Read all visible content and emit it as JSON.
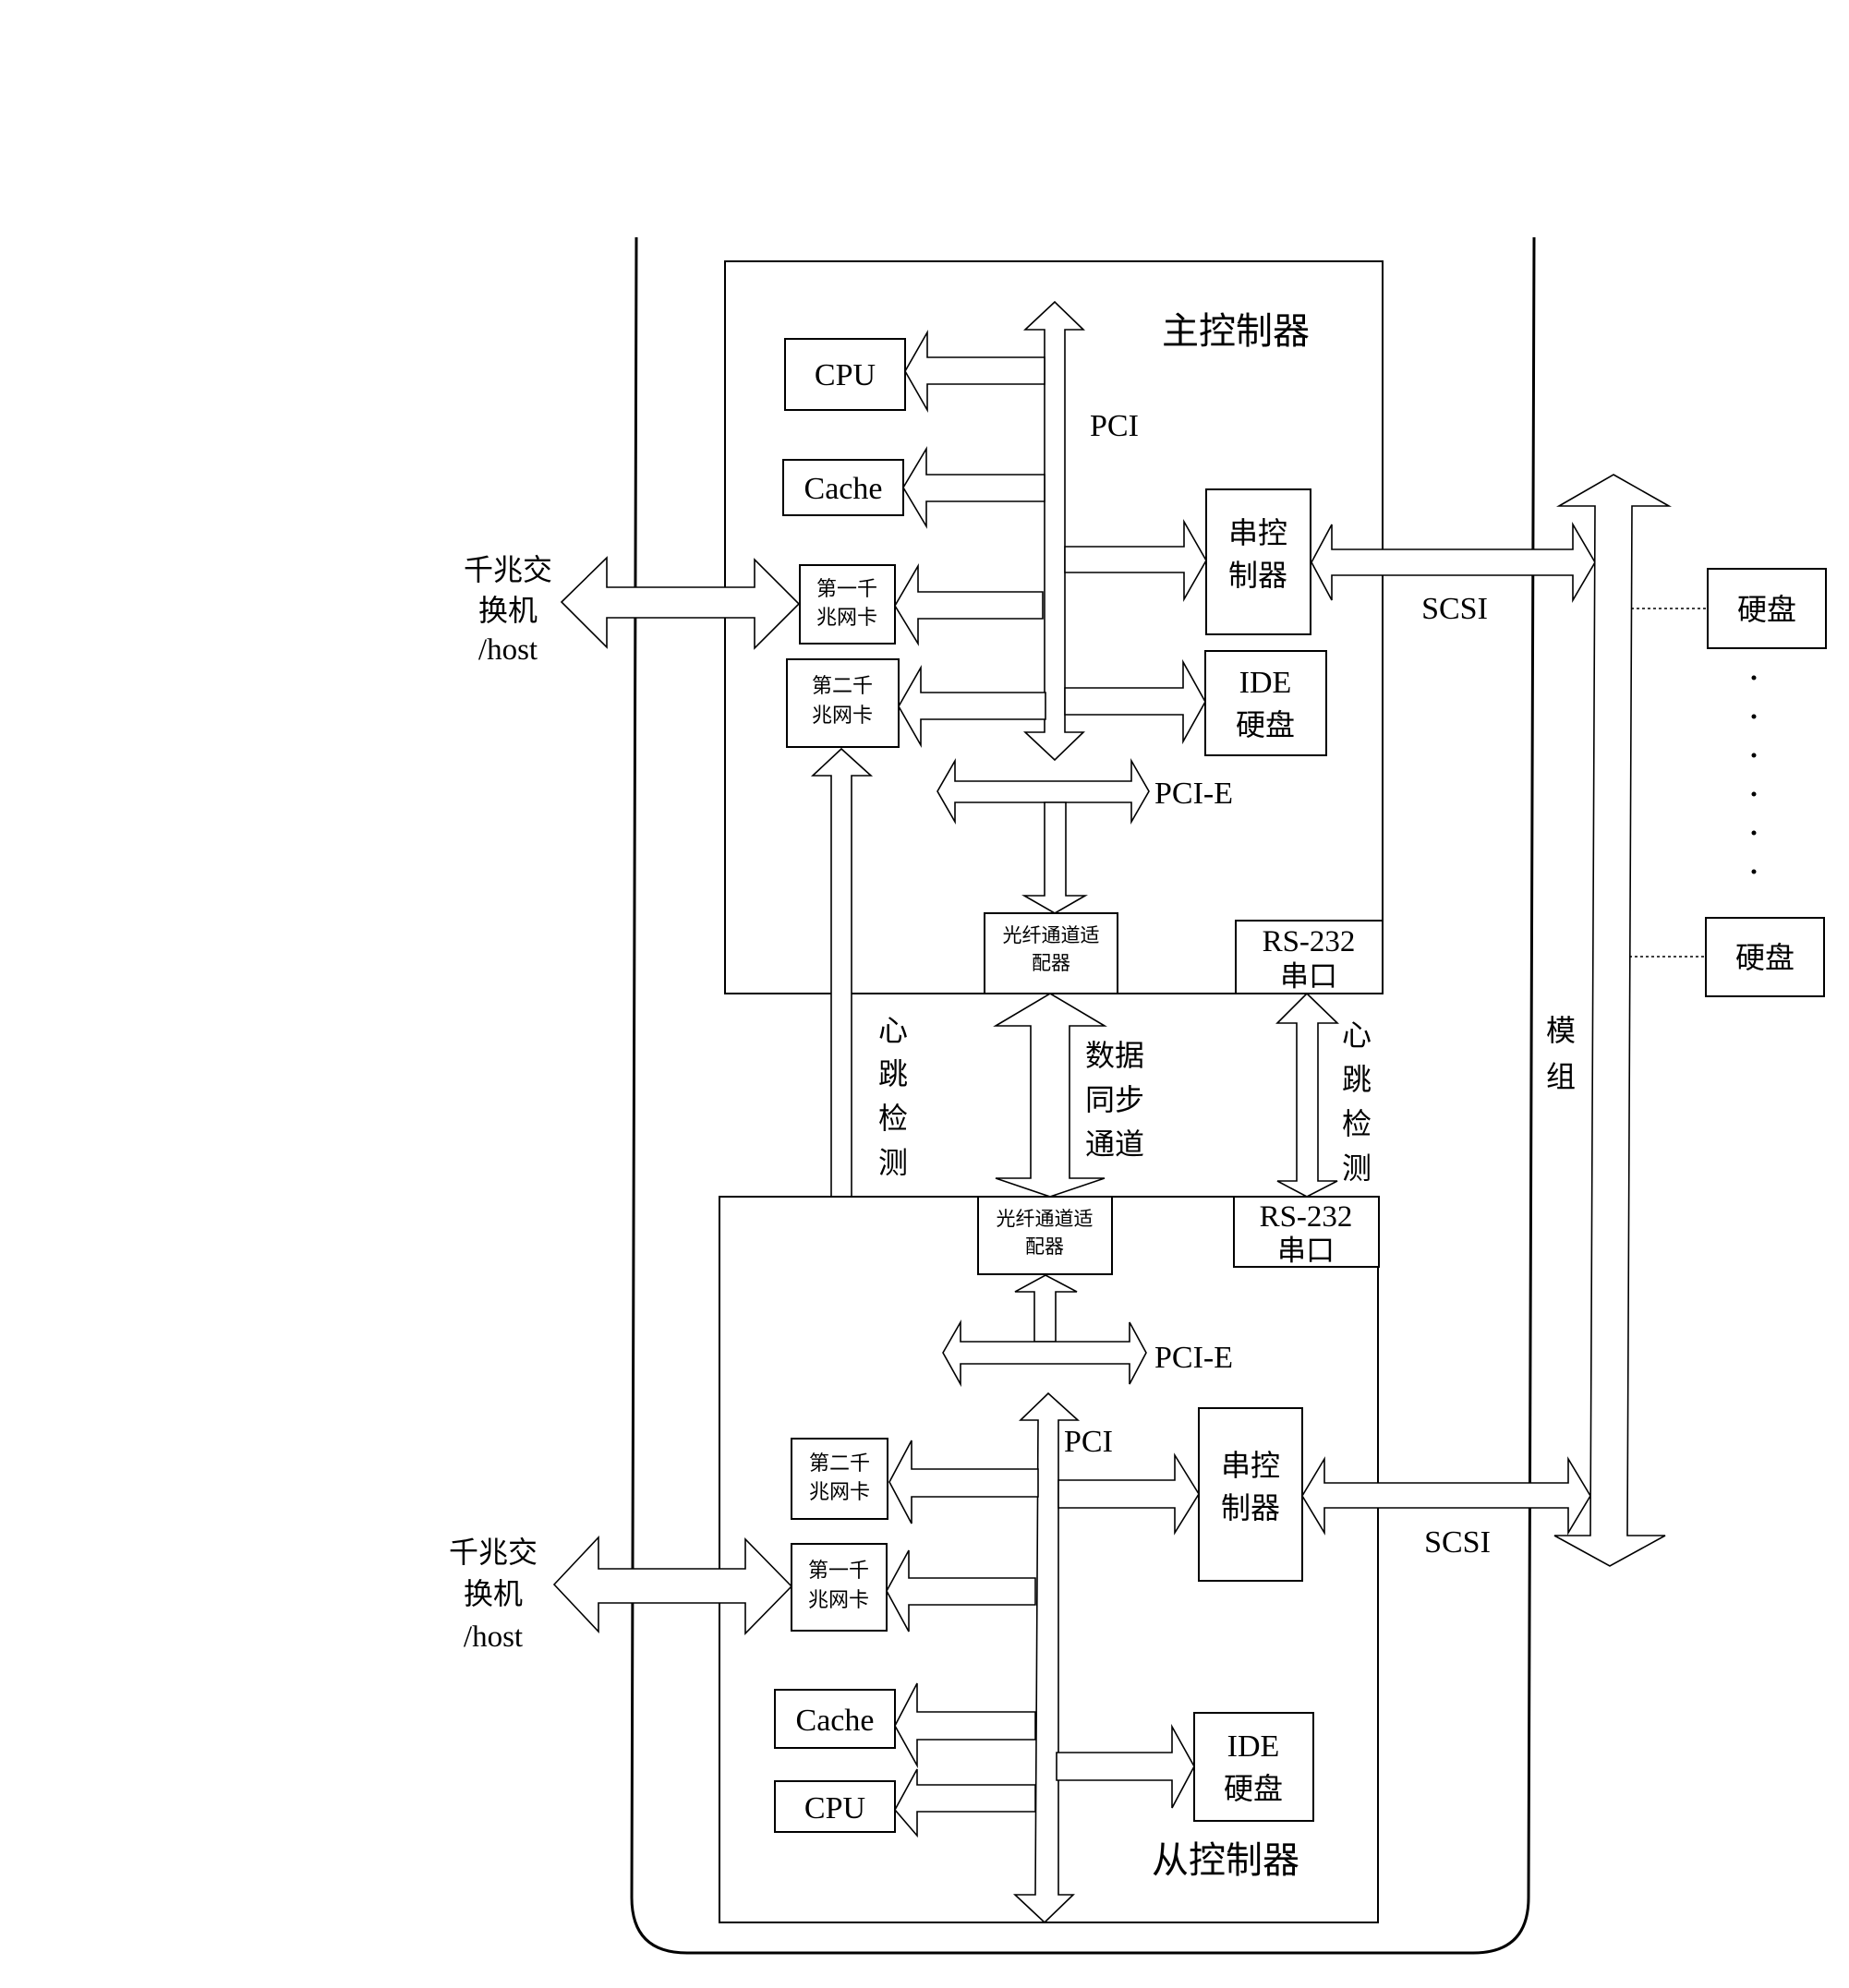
{
  "diagram": {
    "master_controller": {
      "title": "主控制器",
      "cpu": "CPU",
      "cache": "Cache",
      "nic1": [
        "第一千",
        "兆网卡"
      ],
      "nic2": [
        "第二千",
        "兆网卡"
      ],
      "serial_controller": [
        "串控",
        "制器"
      ],
      "ide_disk": [
        "IDE",
        "硬盘"
      ],
      "pci_label": "PCI",
      "pcie_label": "PCI-E",
      "fc_adapter": [
        "光纤通道适",
        "配器"
      ],
      "rs232": [
        "RS-232",
        "串口"
      ],
      "scsi_label": "SCSI"
    },
    "slave_controller": {
      "title": "从控制器",
      "cpu": "CPU",
      "cache": "Cache",
      "nic1": [
        "第一千",
        "兆网卡"
      ],
      "nic2": [
        "第二千",
        "兆网卡"
      ],
      "serial_controller": [
        "串控",
        "制器"
      ],
      "ide_disk": [
        "IDE",
        "硬盘"
      ],
      "pci_label": "PCI",
      "pcie_label": "PCI-E",
      "fc_adapter": [
        "光纤通道适",
        "配器"
      ],
      "rs232": [
        "RS-232",
        "串口"
      ],
      "scsi_label": "SCSI"
    },
    "host_label_top": [
      "千兆交",
      "换机",
      "/host"
    ],
    "host_label_bottom": [
      "千兆交",
      "换机",
      "/host"
    ],
    "heartbeat_left": [
      "心",
      "跳",
      "检",
      "测"
    ],
    "heartbeat_right": [
      "心",
      "跳",
      "检",
      "测"
    ],
    "data_sync": [
      "数据",
      "同步",
      "通道"
    ],
    "module_label": [
      "模",
      "组"
    ],
    "disks": [
      "硬盘",
      "硬盘"
    ],
    "ellipsis_dot_count": 6
  }
}
